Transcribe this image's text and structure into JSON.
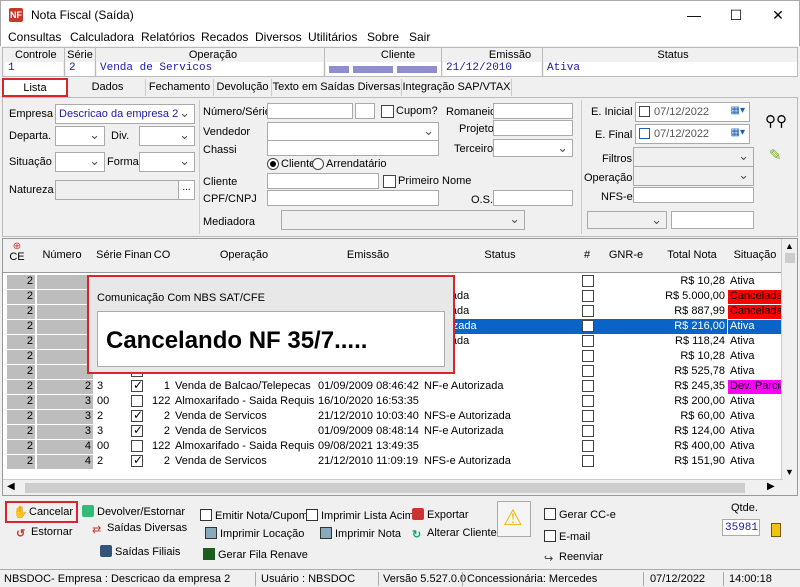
{
  "window": {
    "title": "Nota Fiscal (Saída)",
    "app_icon": "NF",
    "minimize": "—",
    "maximize": "☐",
    "close": "✕"
  },
  "menu": [
    "Consultas",
    "Calculadora",
    "Relatórios",
    "Recados",
    "Diversos",
    "Utilitários",
    "Sobre",
    "Sair"
  ],
  "info": {
    "controle_label": "Controle",
    "controle": "1",
    "serie_label": "Série",
    "serie": "2",
    "operacao_label": "Operação",
    "operacao": "Venda de Servicos",
    "cliente_label": "Cliente",
    "cliente": "",
    "emissao_label": "Emissão",
    "emissao": "21/12/2010",
    "status_label": "Status",
    "status": "Ativa"
  },
  "tabs": [
    "Lista",
    "Dados",
    "Fechamento",
    "Devolução",
    "Texto em Saídas Diversas",
    "Integração SAP/VTAX"
  ],
  "filters": {
    "empresa_label": "Empresa",
    "empresa": "Descricao da empresa 2",
    "departa_label": "Departa.",
    "div_label": "Div.",
    "situacao_label": "Situação",
    "forma_label": "Forma",
    "natureza_label": "Natureza",
    "natureza_btn": "...",
    "numero_serie_label": "Número/Série",
    "cupom_label": "Cupom?",
    "romaneio_label": "Romaneio",
    "vendedor_label": "Vendedor",
    "projeto_label": "Projeto",
    "chassi_label": "Chassi",
    "terceiro_label": "Terceiro",
    "radio_cliente": "Cliente",
    "radio_arrendatario": "Arrendatário",
    "cliente_label": "Cliente",
    "primeiro_nome_label": "Primeiro Nome",
    "cpf_label": "CPF/CNPJ",
    "os_label": "O.S.",
    "mediadora_label": "Mediadora",
    "e_inicial_label": "E. Inicial",
    "e_inicial": "07/12/2022",
    "e_final_label": "E. Final",
    "e_final": "07/12/2022",
    "filtros_label": "Filtros",
    "operacao_label": "Operação",
    "nfse_label": "NFS-e"
  },
  "grid": {
    "headers": [
      "CE",
      "Número",
      "Série",
      "Finan",
      "CO",
      "Operação",
      "Emissão",
      "Status",
      "#",
      "GNR-e",
      "Total Nota",
      "Situação"
    ],
    "rows": [
      {
        "ce": "2",
        "numero": "",
        "serie": "",
        "finan": "",
        "co": "",
        "operacao": "",
        "emissao": "",
        "status": "",
        "total": "R$ 10,28",
        "situacao": "Ativa",
        "sit_color": "#ffffff",
        "selected": false
      },
      {
        "ce": "2",
        "numero": "",
        "serie": "",
        "finan": "",
        "co": "",
        "operacao": "",
        "emissao": "",
        "status": "utorizada",
        "total": "R$ 5.000,00",
        "situacao": "Cancelada",
        "sit_color": "#ff0000",
        "selected": false
      },
      {
        "ce": "2",
        "numero": "",
        "serie": "",
        "finan": "",
        "co": "",
        "operacao": "",
        "emissao": "",
        "status": "utorizada",
        "total": "R$ 887,99",
        "situacao": "Cancelada",
        "sit_color": "#ff0000",
        "selected": false
      },
      {
        "ce": "2",
        "numero": "",
        "serie": "",
        "finan": "",
        "co": "",
        "operacao": "",
        "emissao": "",
        "status": "Autorizada",
        "total": "R$ 216,00",
        "situacao": "Ativa",
        "sit_color": "#0a64c8",
        "selected": true
      },
      {
        "ce": "2",
        "numero": "",
        "serie": "",
        "finan": "",
        "co": "",
        "operacao": "",
        "emissao": "",
        "status": "utorizada",
        "total": "R$ 118,24",
        "situacao": "Ativa",
        "sit_color": "#ffffff",
        "selected": false
      },
      {
        "ce": "2",
        "numero": "",
        "serie": "",
        "finan": "",
        "co": "",
        "operacao": "",
        "emissao": "",
        "status": "",
        "total": "R$ 10,28",
        "situacao": "Ativa",
        "sit_color": "#ffffff",
        "selected": false
      },
      {
        "ce": "2",
        "numero": "",
        "serie": "",
        "finan": "",
        "co": "",
        "operacao": "",
        "emissao": "",
        "status": "",
        "total": "R$ 525,78",
        "situacao": "Ativa",
        "sit_color": "#ffffff",
        "selected": false
      },
      {
        "ce": "2",
        "numero": "2",
        "serie": "3",
        "finan": "✓",
        "co": "1",
        "operacao": "Venda de Balcao/Telepecas",
        "emissao": "01/09/2009 08:46:42",
        "status": "NF-e Autorizada",
        "total": "R$ 245,35",
        "situacao": "Dev. Parcia",
        "sit_color": "#ff00ff",
        "selected": false
      },
      {
        "ce": "2",
        "numero": "3",
        "serie": "00",
        "finan": "",
        "co": "122",
        "operacao": "Almoxarifado - Saida Requisicao",
        "emissao": "16/10/2020 16:53:35",
        "status": "",
        "total": "R$ 200,00",
        "situacao": "Ativa",
        "sit_color": "#ffffff",
        "selected": false
      },
      {
        "ce": "2",
        "numero": "3",
        "serie": "2",
        "finan": "✓",
        "co": "2",
        "operacao": "Venda de Servicos",
        "emissao": "21/12/2010 10:03:40",
        "status": "NFS-e Autorizada",
        "total": "R$ 60,00",
        "situacao": "Ativa",
        "sit_color": "#ffffff",
        "selected": false
      },
      {
        "ce": "2",
        "numero": "3",
        "serie": "3",
        "finan": "✓",
        "co": "2",
        "operacao": "Venda de Servicos",
        "emissao": "01/09/2009 08:48:14",
        "status": "NF-e Autorizada",
        "total": "R$ 124,00",
        "situacao": "Ativa",
        "sit_color": "#ffffff",
        "selected": false
      },
      {
        "ce": "2",
        "numero": "4",
        "serie": "00",
        "finan": "",
        "co": "122",
        "operacao": "Almoxarifado - Saida Requisicao",
        "emissao": "09/08/2021 13:49:35",
        "status": "",
        "total": "R$ 400,00",
        "situacao": "Ativa",
        "sit_color": "#ffffff",
        "selected": false
      },
      {
        "ce": "2",
        "numero": "4",
        "serie": "2",
        "finan": "✓",
        "co": "2",
        "operacao": "Venda de Servicos",
        "emissao": "21/12/2010 11:09:19",
        "status": "NFS-e Autorizada",
        "total": "R$ 151,90",
        "situacao": "Ativa",
        "sit_color": "#ffffff",
        "selected": false
      }
    ]
  },
  "dialog": {
    "title": "Comunicação Com NBS SAT/CFE",
    "message": "Cancelando  NF 35/7....."
  },
  "toolbar": {
    "cancelar": "Cancelar",
    "estornar": "Estornar",
    "devolver": "Devolver/Estornar",
    "saidas_diversas": "Saídas Diversas",
    "saidas_filiais": "Saídas Filiais",
    "emitir_nota": "Emitir Nota/Cupom",
    "imprimir_locacao": "Imprimir Locação",
    "gerar_fila": "Gerar Fila Renave",
    "imprimir_lista": "Imprimir Lista Acima",
    "imprimir_nota": "Imprimir Nota",
    "exportar": "Exportar",
    "alterar_cliente": "Alterar Cliente",
    "gerar_cce": "Gerar CC-e",
    "email": "E-mail",
    "reenviar": "Reenviar",
    "qtde_label": "Qtde.",
    "qtde": "35981"
  },
  "status": {
    "sistema": "NBSDOC- Empresa : Descricao da empresa 2",
    "usuario": "Usuário : NBSDOC",
    "versao": "Versão 5.527.0.0",
    "concessionaria": "Concessionária: Mercedes",
    "data": "07/12/2022",
    "hora": "14:00:18"
  },
  "colors": {
    "accent_red": "#d9262c",
    "selected_row": "#0a64c8",
    "cancel_red": "#ff0000",
    "dev_magenta": "#ff00ff",
    "value_blue": "#1a1aa6"
  }
}
